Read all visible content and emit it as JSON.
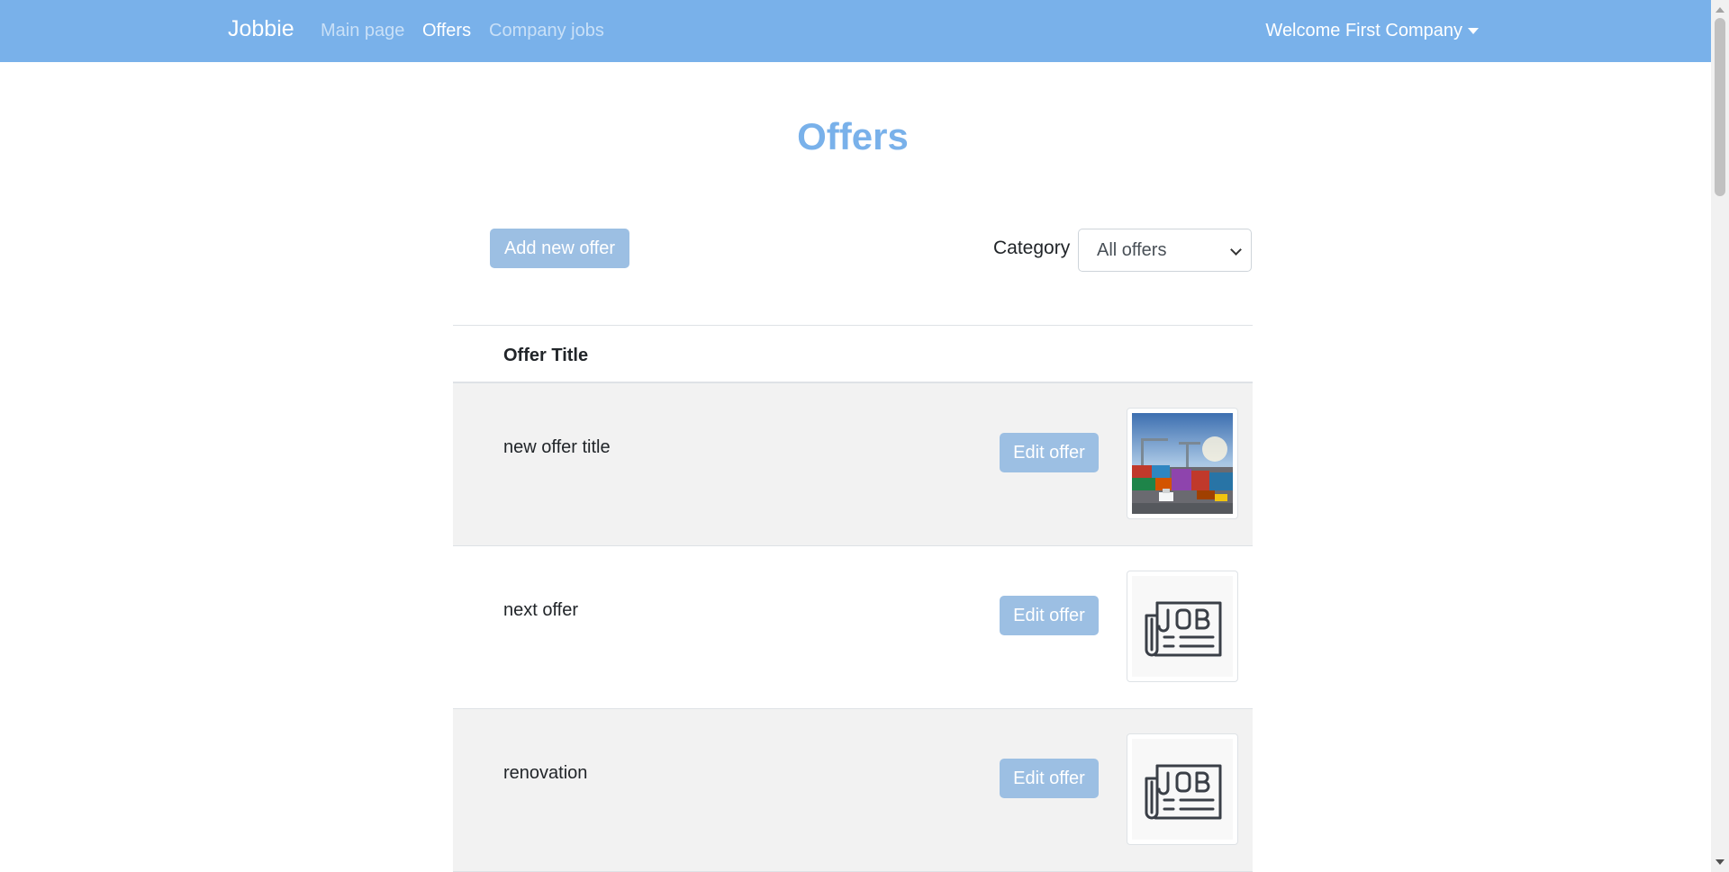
{
  "navbar": {
    "brand": "Jobbie",
    "links": [
      {
        "label": "Main page"
      },
      {
        "label": "Offers"
      },
      {
        "label": "Company jobs"
      }
    ],
    "user_menu": "Welcome First Company"
  },
  "page": {
    "title": "Offers"
  },
  "toolbar": {
    "add_label": "Add new offer",
    "category_label": "Category",
    "category_selected": "All offers"
  },
  "table": {
    "header": "Offer Title",
    "rows": [
      {
        "title": "new offer title",
        "edit_label": "Edit offer",
        "image": "container-port-photo"
      },
      {
        "title": "next offer",
        "edit_label": "Edit offer",
        "image": "job-newspaper-icon"
      },
      {
        "title": "renovation",
        "edit_label": "Edit offer",
        "image": "job-newspaper-icon"
      }
    ]
  },
  "colors": {
    "navbar": "#79b1ea",
    "title": "#79b1ea",
    "button": "#9cbfe3",
    "stripe": "#f2f2f2"
  }
}
